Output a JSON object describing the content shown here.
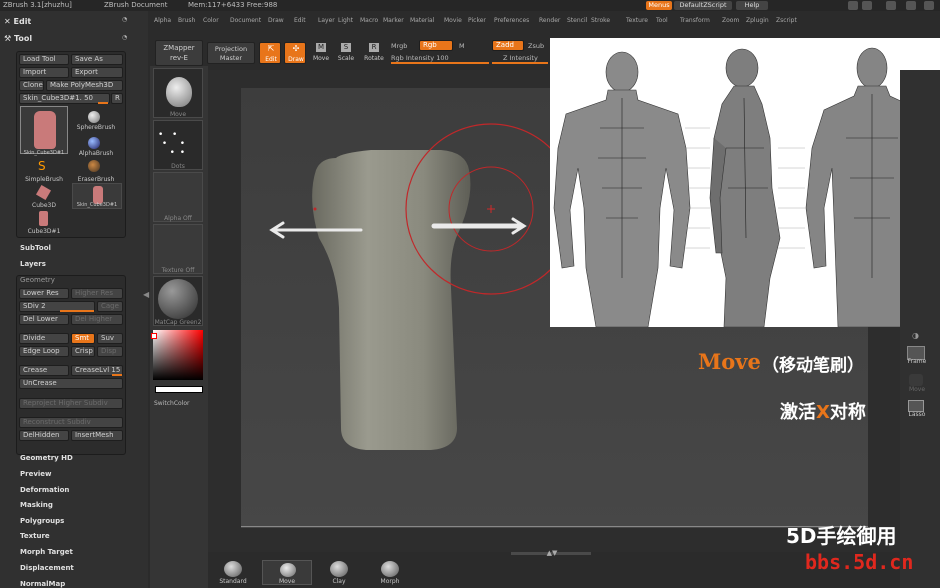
{
  "titlebar": {
    "app": "ZBrush 3.1[zhuzhu]",
    "doc": "ZBrush Document",
    "mem": "Mem:117+6433 Free:988"
  },
  "topright": {
    "menus": "Menus",
    "script": "DefaultZScript",
    "help": "Help"
  },
  "menu": [
    "Alpha",
    "Brush",
    "Color",
    "Document",
    "Draw",
    "Edit",
    "Layer",
    "Light",
    "Macro",
    "Marker",
    "Material",
    "Movie",
    "Picker",
    "Preferences",
    "Render",
    "Stencil",
    "Stroke",
    "Texture",
    "Tool",
    "Transform",
    "Zoom",
    "Zplugin",
    "Zscript"
  ],
  "left": {
    "edit": "Edit",
    "tool": "Tool",
    "load_tool": "Load Tool",
    "save_as": "Save As",
    "import": "Import",
    "export": "Export",
    "clone": "Clone",
    "make_polymesh": "Make PolyMesh3D",
    "skin_slider": "Skin_Cube3D#1. 50",
    "r": "R",
    "brushes": [
      "Skin_Cube3D#1",
      "SphereBrush",
      "AlphaBrush",
      "SimpleBrush",
      "EraserBrush",
      "Cube3D",
      "Skin_Cube3D#1",
      "Cube3D#1"
    ],
    "subtool": "SubTool",
    "layers": "Layers",
    "geometry": "Geometry",
    "lower_res": "Lower Res",
    "higher_res": "Higher Res",
    "sdiv": "SDiv 2",
    "cage": "Cage",
    "del_lower": "Del Lower",
    "del_higher": "Del Higher",
    "divide": "Divide",
    "smt": "Smt",
    "suv": "Suv",
    "edge_loop": "Edge Loop",
    "crisp": "Crisp",
    "disp": "Disp",
    "crease": "Crease",
    "creaselvl": "CreaseLvl 15",
    "uncrease": "UnCrease",
    "reproject": "Reproject Higher Subdiv",
    "reconstruct": "Reconstruct Subdiv",
    "delhidden": "DelHidden",
    "insertmesh": "InsertMesh",
    "sections": [
      "Geometry HD",
      "Preview",
      "Deformation",
      "Masking",
      "Polygroups",
      "Texture",
      "Morph Target",
      "Displacement",
      "NormalMap"
    ]
  },
  "toolbar": {
    "zmapper": "ZMapper",
    "zmapper_rev": "rev-E",
    "projection": "Projection",
    "master": "Master",
    "edit": "Edit",
    "draw": "Draw",
    "move": "Move",
    "scale": "Scale",
    "rotate": "Rotate",
    "mrgb": "Mrgb",
    "rgb": "Rgb",
    "m": "M",
    "rgb_intensity": "Rgb Intensity 100",
    "zadd": "Zadd",
    "zsub": "Zsub",
    "z_intensity": "Z Intensity"
  },
  "brushcol": {
    "move": "Move",
    "dots": "Dots",
    "alpha": "Alpha Off",
    "texture": "Texture Off",
    "matcap": "MatCap Green2",
    "switchcolor": "SwitchColor"
  },
  "rightcol": {
    "frame": "Frame",
    "move": "Move",
    "lasso": "Lasso"
  },
  "bottom": {
    "standard": "Standard",
    "move": "Move",
    "clay": "Clay",
    "morph": "Morph"
  },
  "overlay": {
    "title": "Move",
    "title_cn": "（移动笔刷）",
    "line2a": "激活",
    "x": "X",
    "line2b": "对称",
    "watermark1": "5D手绘御用",
    "watermark2": "bbs.5d.cn"
  },
  "colors": {
    "accent": "#e8751a",
    "bg": "#2b2b2b"
  }
}
